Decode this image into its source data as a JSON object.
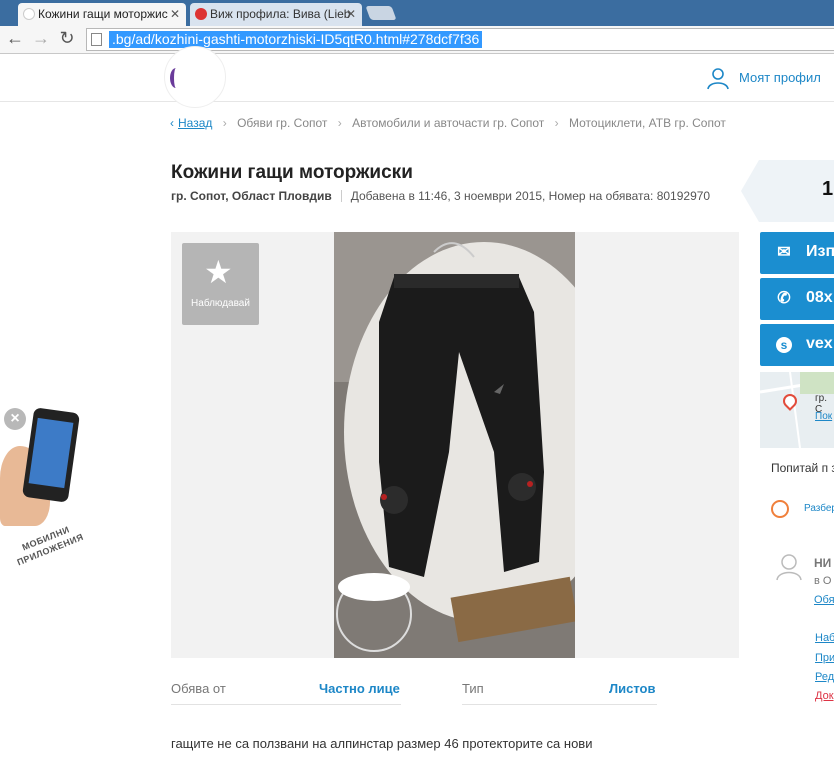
{
  "browser": {
    "tabs": [
      {
        "label": "Кожини гащи моторжис",
        "active": true
      },
      {
        "label": "Виж профила: Вива (Lieb",
        "active": false
      }
    ],
    "url": ".bg/ad/kozhini-gashti-motorzhiski-ID5qtR0.html#278dcf7f36"
  },
  "header": {
    "profile_label": "Моят профил"
  },
  "breadcrumb": {
    "back_label": "Назад",
    "items": [
      "Обяви гр. Сопот",
      "Автомобили и авточасти гр. Сопот",
      "Мотоциклети, АТВ гр. Сопот"
    ]
  },
  "ad": {
    "title": "Кожини гащи моторжиски",
    "location": "гр. Сопот, Област Пловдив",
    "added": "Добавена в 11:46, 3 ноември 2015, Номер на обявата: 80192970",
    "follow_label": "Наблюдавай",
    "details": [
      {
        "label": "Обява от",
        "value": "Частно лице"
      },
      {
        "label": "Тип",
        "value": "Листов"
      }
    ],
    "description": "гащите не са ползвани на алпинстар размер 46 протекторите са нови"
  },
  "sidebar": {
    "price": "1",
    "buttons": [
      {
        "icon": "envelope-icon",
        "label": "Изп"
      },
      {
        "icon": "phone-icon",
        "label": "08x"
      },
      {
        "icon": "skype-icon",
        "label": "vex"
      }
    ],
    "map_city": "гр. С",
    "map_link": "Пок",
    "ask_text": "Попитай п за доставк",
    "delivery_link": "Разбер",
    "seller_name": "НИ",
    "seller_since": "в О",
    "seller_link": "Обя",
    "seller_links": [
      "Наб",
      "При",
      "Ред",
      "Док"
    ]
  },
  "promo": {
    "close": "×",
    "text": "МОБИЛНИ ПРИЛОЖЕНИЯ"
  },
  "colors": {
    "accent": "#1b8ed0",
    "link": "#1d87c7",
    "chrome_bar": "#3b6da0"
  }
}
